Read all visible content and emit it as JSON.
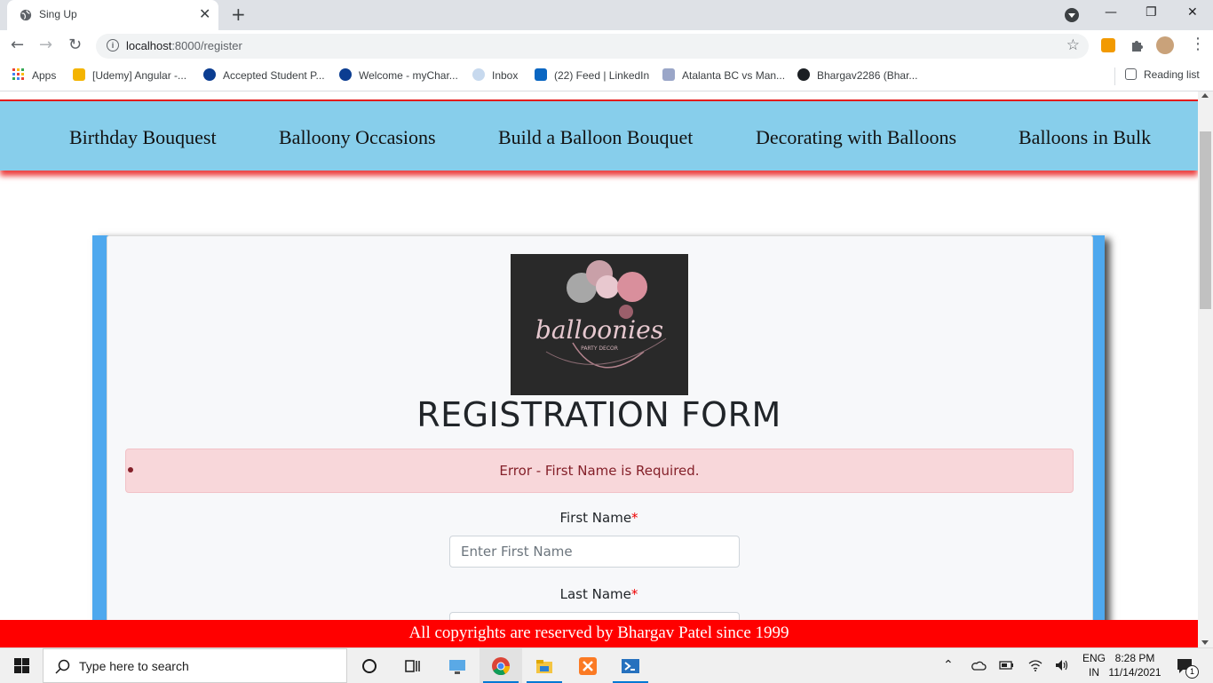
{
  "browser": {
    "tab_title": "Sing Up",
    "url_host": "localhost",
    "url_path": ":8000/register",
    "bookmarks": [
      {
        "label": "Apps",
        "icon": "apps-grid-icon"
      },
      {
        "label": "[Udemy] Angular -...",
        "icon": "udemy-icon"
      },
      {
        "label": "Accepted Student P...",
        "icon": "college-icon"
      },
      {
        "label": "Welcome - myChar...",
        "icon": "college-icon"
      },
      {
        "label": "Inbox",
        "icon": "mail-icon"
      },
      {
        "label": "(22) Feed | LinkedIn",
        "icon": "linkedin-icon"
      },
      {
        "label": "Atalanta BC vs Man...",
        "icon": "football-icon"
      },
      {
        "label": "Bhargav2286 (Bhar...",
        "icon": "github-icon"
      }
    ],
    "reading_list": "Reading list"
  },
  "nav": {
    "items": [
      "Birthday Bouquest",
      "Balloony Occasions",
      "Build a Balloon Bouquet",
      "Decorating with Balloons",
      "Balloons in Bulk"
    ]
  },
  "logo": {
    "brand": "balloonies",
    "tagline": "PARTY DECOR"
  },
  "form": {
    "title": "REGISTRATION FORM",
    "error": "Error - First Name is Required.",
    "first_name_label": "First Name",
    "first_name_placeholder": "Enter First Name",
    "last_name_label": "Last Name",
    "required_mark": "*"
  },
  "footer": {
    "text": "All copyrights are reserved by Bhargav Patel since 1999"
  },
  "taskbar": {
    "search_placeholder": "Type here to search",
    "lang_top": "ENG",
    "lang_bottom": "IN",
    "time": "8:28 PM",
    "date": "11/14/2021",
    "notification_count": "1"
  },
  "colors": {
    "nav_bg": "#87ceeb",
    "accent_red": "#ff0000",
    "card_border_blue": "#4ea8ee",
    "alert_bg": "#f8d7da",
    "alert_text": "#842029"
  }
}
